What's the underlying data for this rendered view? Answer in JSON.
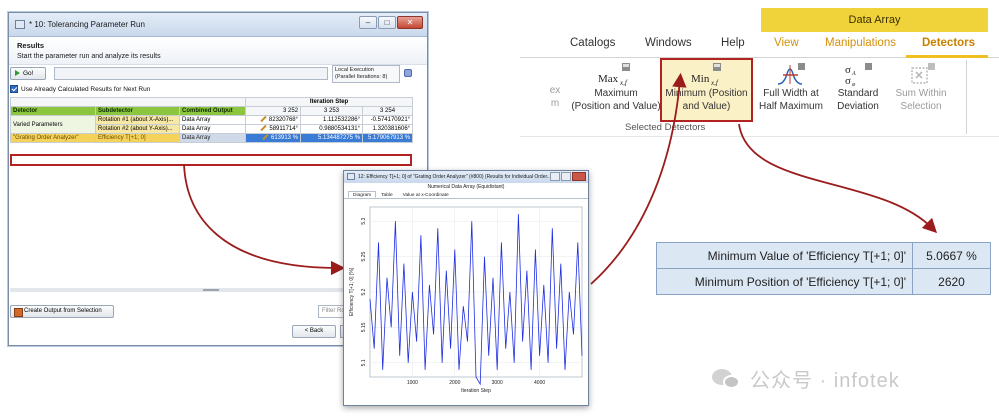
{
  "main_window": {
    "title": "* 10: Tolerancing Parameter Run",
    "results_title": "Results",
    "instruction": "Start the parameter run and analyze its results",
    "go_label": "Go!",
    "local_execution": "Local Execution",
    "parallel_iterations": "(Parallel Iterations: 8)",
    "use_cached_label": "Use Already Calculated Results for Next Run",
    "iteration_step_label": "Iteration Step",
    "columns": [
      "Detector",
      "Subdetector",
      "Combined Output",
      "3 252",
      "3 253",
      "3 254"
    ],
    "rows": [
      {
        "detector": "Varied Parameters",
        "subdetector": "Rotation #1 (about X-Axis)...",
        "output": "Data Array",
        "v1": "82320768°",
        "v2": "1.112532286°",
        "v3": "-0.574170921°"
      },
      {
        "detector": "",
        "subdetector": "Rotation #2 (about Y-Axis)...",
        "output": "Data Array",
        "v1": "58911714°",
        "v2": "0.9880534131°",
        "v3": "1.320381606°"
      },
      {
        "detector": "\"Grating Order Analyzer\"",
        "subdetector": "Efficiency T[+1; 0]",
        "output": "Data Array",
        "v1": "613913 %",
        "v2": "5.134487275 %",
        "v3": "5.179067913 %"
      }
    ],
    "create_output_label": "Create Output from Selection",
    "filter_placeholder": "Filter Rows",
    "back_label": "< Back"
  },
  "plot_window": {
    "title": "12: Efficiency T[+1; 0] of \"Grating Order Analyzer\" (#800) (Results for Individual Order...",
    "subtitle": "Numerical Data Array (Equidistant)",
    "tabs": [
      "Diagram",
      "Table",
      "Value at x-Coordinate"
    ]
  },
  "ribbon": {
    "context_label": "Data Array",
    "tabs": [
      "Catalogs",
      "Windows",
      "Help",
      "View",
      "Manipulations",
      "Detectors"
    ],
    "items": [
      {
        "line1": "ex",
        "line2": "m"
      },
      {
        "line1": "Maximum",
        "line2": "(Position and Value)"
      },
      {
        "line1": "Minimum (Position",
        "line2": "and Value)"
      },
      {
        "line1": "Full Width at",
        "line2": "Half Maximum"
      },
      {
        "line1": "Standard",
        "line2": "Deviation"
      },
      {
        "line1": "Sum Within",
        "line2": "Selection"
      }
    ],
    "group_label": "Selected Detectors"
  },
  "result_table": [
    {
      "label": "Minimum Value of 'Efficiency T[+1; 0]'",
      "value": "5.0667 %"
    },
    {
      "label": "Minimum Position of 'Efficiency T[+1; 0]'",
      "value": "2620"
    }
  ],
  "watermark": "公众号 · infotek",
  "colors": {
    "accent_red": "#b22222",
    "ribbon_yellow": "#f0d33a",
    "plot_line": "#1e2ee0",
    "grid_green": "#8cc63f"
  },
  "chart_data": {
    "type": "line",
    "title": "",
    "xlabel": "Iteration Step",
    "ylabel": "Efficiency T[+1; 0] [%]",
    "xlim": [
      0,
      5000
    ],
    "ylim": [
      5.08,
      5.32
    ],
    "xticks": [
      1000,
      2000,
      3000,
      4000
    ],
    "yticks": [
      5.1,
      5.15,
      5.2,
      5.25,
      5.3
    ],
    "ytick_labels": [
      "5.1",
      "5.15",
      "5.2",
      "5.25",
      "5.3"
    ],
    "series": [
      {
        "x": [
          0,
          100,
          200,
          300,
          400,
          500,
          600,
          700,
          800,
          900,
          1000,
          1100,
          1200,
          1300,
          1400,
          1500,
          1600,
          1700,
          1800,
          1900,
          2000,
          2100,
          2200,
          2300,
          2400,
          2500,
          2600,
          2700,
          2800,
          2900,
          3000,
          3100,
          3200,
          3300,
          3400,
          3500,
          3600,
          3700,
          3800,
          3900,
          4000,
          4100,
          4200,
          4300,
          4400,
          4500,
          4600,
          4700,
          4800,
          4900,
          5000
        ],
        "y": [
          5.19,
          5.12,
          5.27,
          5.09,
          5.22,
          5.15,
          5.3,
          5.11,
          5.24,
          5.1,
          5.2,
          5.13,
          5.28,
          5.09,
          5.21,
          5.14,
          5.29,
          5.1,
          5.23,
          5.12,
          5.26,
          5.09,
          5.18,
          5.13,
          5.3,
          5.08,
          5.07,
          5.25,
          5.11,
          5.22,
          5.09,
          5.27,
          5.12,
          5.2,
          5.1,
          5.31,
          5.13,
          5.23,
          5.09,
          5.26,
          5.11,
          5.21,
          5.1,
          5.29,
          5.12,
          5.24,
          5.09,
          5.2,
          5.14,
          5.27,
          5.11
        ]
      }
    ]
  }
}
